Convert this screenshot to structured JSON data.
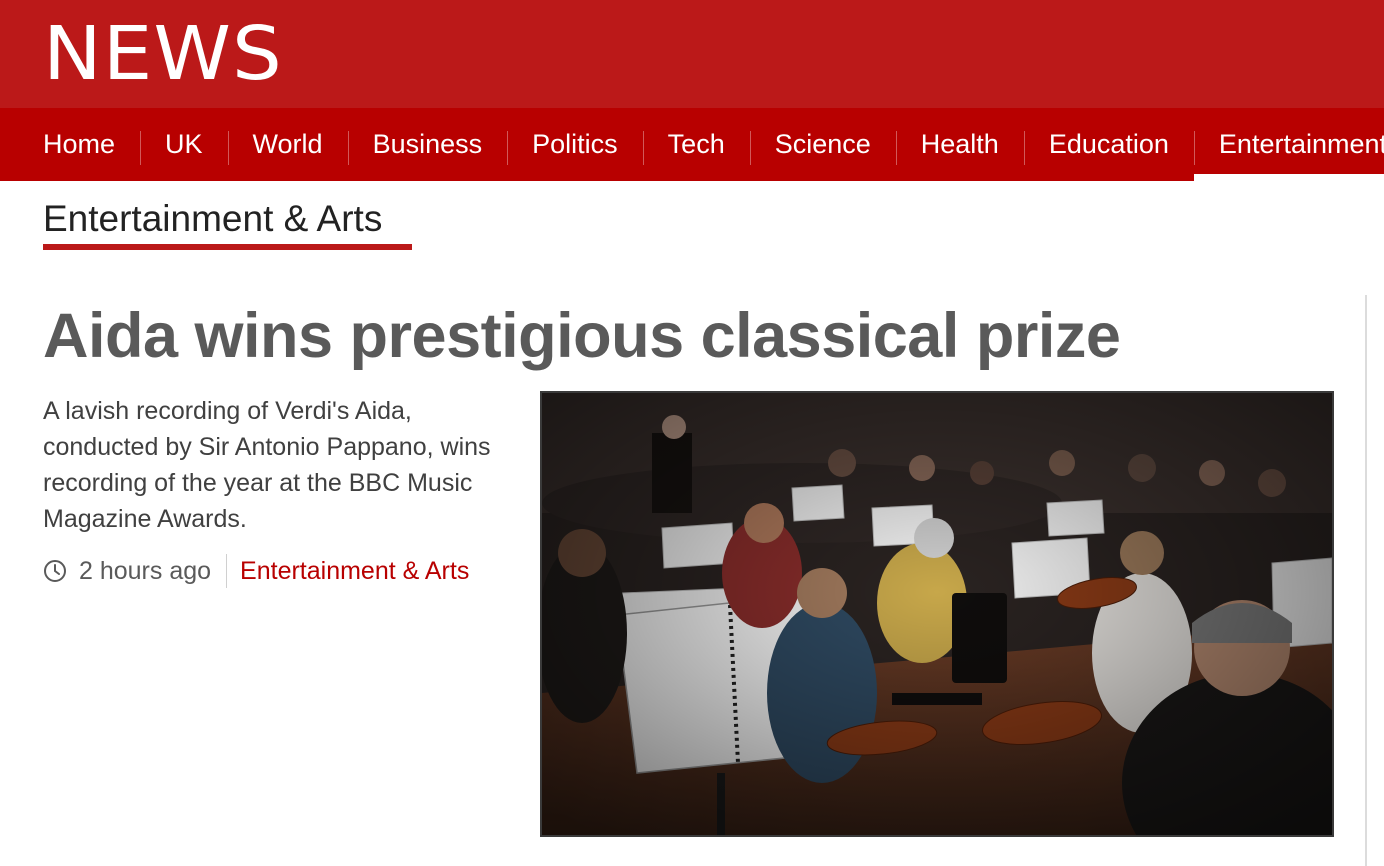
{
  "brand": {
    "logo_text": "NEWS"
  },
  "nav": {
    "items": [
      {
        "label": "Home"
      },
      {
        "label": "UK"
      },
      {
        "label": "World"
      },
      {
        "label": "Business"
      },
      {
        "label": "Politics"
      },
      {
        "label": "Tech"
      },
      {
        "label": "Science"
      },
      {
        "label": "Health"
      },
      {
        "label": "Education"
      },
      {
        "label": "Entertainment & Arts"
      }
    ],
    "active_index": 9
  },
  "section": {
    "title": "Entertainment & Arts"
  },
  "article": {
    "headline": "Aida wins prestigious classical prize",
    "summary": "A lavish recording of Verdi's Aida, conducted by Sir Antonio Pappano, wins recording of the year at the BBC Music Magazine Awards.",
    "timestamp": "2 hours ago",
    "section_link": "Entertainment & Arts",
    "image_icon": "orchestra-photo"
  },
  "colors": {
    "brand_red": "#bb1919",
    "nav_red": "#b80000",
    "headline_grey": "#5a5a5a",
    "text_grey": "#404040"
  }
}
